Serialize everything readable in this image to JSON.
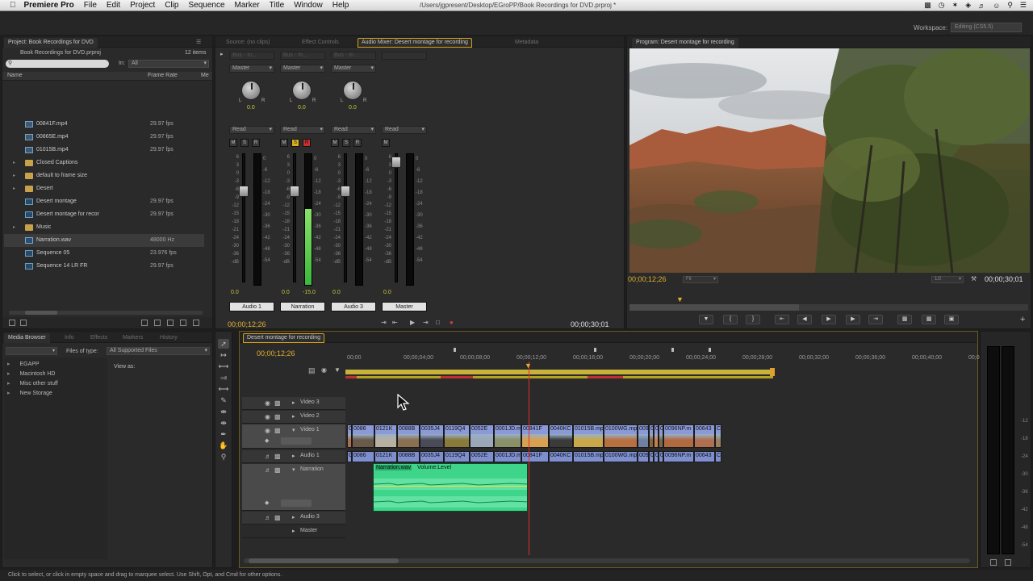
{
  "menubar": {
    "app": "Premiere Pro",
    "items": [
      "File",
      "Edit",
      "Project",
      "Clip",
      "Sequence",
      "Marker",
      "Title",
      "Window",
      "Help"
    ],
    "path": "/Users/jgpresent/Desktop/EGroPP/Book Recordings for DVD.prproj *"
  },
  "workspace": {
    "label": "Workspace:",
    "value": "Editing (CS5.5)"
  },
  "project": {
    "tab": "Project: Book Recordings for DVD",
    "file": "Book Recordings for DVD.prproj",
    "item_count": "12 items",
    "in_label": "In:",
    "in_value": "All",
    "col_name": "Name",
    "col_rate": "Frame Rate",
    "col_more": "Me",
    "items": [
      {
        "name": "00841F.mp4",
        "rate": "29.97 fps",
        "type": "clip"
      },
      {
        "name": "00865E.mp4",
        "rate": "29.97 fps",
        "type": "clip"
      },
      {
        "name": "01015B.mp4",
        "rate": "29.97 fps",
        "type": "clip"
      },
      {
        "name": "Closed Captions",
        "rate": "",
        "type": "folder"
      },
      {
        "name": "default to frame size",
        "rate": "",
        "type": "folder"
      },
      {
        "name": "Desert",
        "rate": "",
        "type": "folder"
      },
      {
        "name": "Desert montage",
        "rate": "29.97 fps",
        "type": "seq"
      },
      {
        "name": "Desert montage for recor",
        "rate": "29.97 fps",
        "type": "seq"
      },
      {
        "name": "Music",
        "rate": "",
        "type": "folder"
      },
      {
        "name": "Narration.wav",
        "rate": "48000 Hz",
        "type": "audio"
      },
      {
        "name": "Sequence 05",
        "rate": "23.976 fps",
        "type": "seq"
      },
      {
        "name": "Sequence 14 LR FR",
        "rate": "29.97 fps",
        "type": "seq"
      }
    ]
  },
  "mixer": {
    "tabs": [
      "Source: (no clips)",
      "Effect Controls",
      "Audio Mixer: Desert montage for recording",
      "Metadata"
    ],
    "channels": [
      {
        "label": "Audio 1",
        "bus": "Master",
        "auto": "Read",
        "pan": "0.0",
        "vol": "0.0",
        "sub": "Bus - In..."
      },
      {
        "label": "Narration",
        "bus": "Master",
        "auto": "Read",
        "pan": "0.0",
        "vol": "0.0",
        "vol2": "-15.0",
        "sub": "Bus - In..."
      },
      {
        "label": "Audio 3",
        "bus": "Master",
        "auto": "Read",
        "pan": "0.0",
        "vol": "0.0",
        "sub": "Bus - In..."
      },
      {
        "label": "Master",
        "bus": "",
        "auto": "Read",
        "pan": "",
        "vol": "0.0",
        "sub": ""
      }
    ],
    "db_scale": [
      "6",
      "3",
      "0",
      "-3",
      "-6",
      "-9",
      "-12",
      "-15",
      "-18",
      "-21",
      "-24",
      "-30",
      "-36",
      "-dB"
    ],
    "meter_scale": [
      "0",
      "-6",
      "-12",
      "-18",
      "-24",
      "-30",
      "-36",
      "-42",
      "-48",
      "-54"
    ],
    "hsr": [
      "M",
      "S",
      "R"
    ],
    "timecode_in": "00;00;12;26",
    "timecode_out": "00;00;30;01"
  },
  "program": {
    "tab": "Program: Desert montage for recording",
    "timecode": "00;00;12;26",
    "fit": "Fit",
    "res": "1/2",
    "duration": "00;00;30;01"
  },
  "media": {
    "tabs": [
      "Media Browser",
      "Info",
      "Effects",
      "Markers",
      "History"
    ],
    "files_label": "Files of type:",
    "files_value": "All Supported Files",
    "view_as": "View as:",
    "drives": [
      "EGAPP",
      "Macintosh HD",
      "Misc other stuff",
      "New Storage"
    ]
  },
  "timeline": {
    "tab": "Desert montage for recording",
    "timecode": "00;00;12;26",
    "ruler": [
      "00;00",
      "00;00;04;00",
      "00;00;08;00",
      "00;00;12;00",
      "00;00;16;00",
      "00;00;20;00",
      "00;00;24;00",
      "00;00;28;00",
      "00;00;32;00",
      "00;00;36;00",
      "00;00;40;00",
      "00;00"
    ],
    "tracks": [
      "Video 3",
      "Video 2",
      "Video 1",
      "Audio 1",
      "Narration",
      "Audio 3",
      "Master"
    ],
    "video_clips": [
      "Cr",
      "0086",
      "0121K",
      "0088B",
      "0035J4",
      "0119Q4",
      "0052E",
      "0001JD.m",
      "00841F",
      "0040KC",
      "01015B.mp4",
      "0100WG.mp",
      "0099",
      "0",
      "0",
      "0",
      "0096NP.m",
      "00643",
      "C"
    ],
    "audio_clips": [
      "Co",
      "0086",
      "0121K",
      "0088B",
      "0035J4",
      "0119Q4",
      "0052E",
      "0001JD.m",
      "00841F",
      "0040KC",
      "01015B.mp4",
      "0100WG.mp",
      "0099",
      "0",
      "0",
      "0",
      "0096NP.m",
      "00643",
      "C"
    ],
    "narration_clip": "Narration.wav",
    "volume_label": "Volume:Level"
  },
  "status": "Click to select, or click in empty space and drag to marquee select. Use Shift, Opt, and Cmd for other options.",
  "colors": {
    "accent": "#d4a010",
    "playhead": "#e03030",
    "narration": "#3ed48a",
    "clip": "#8a9ad8"
  }
}
